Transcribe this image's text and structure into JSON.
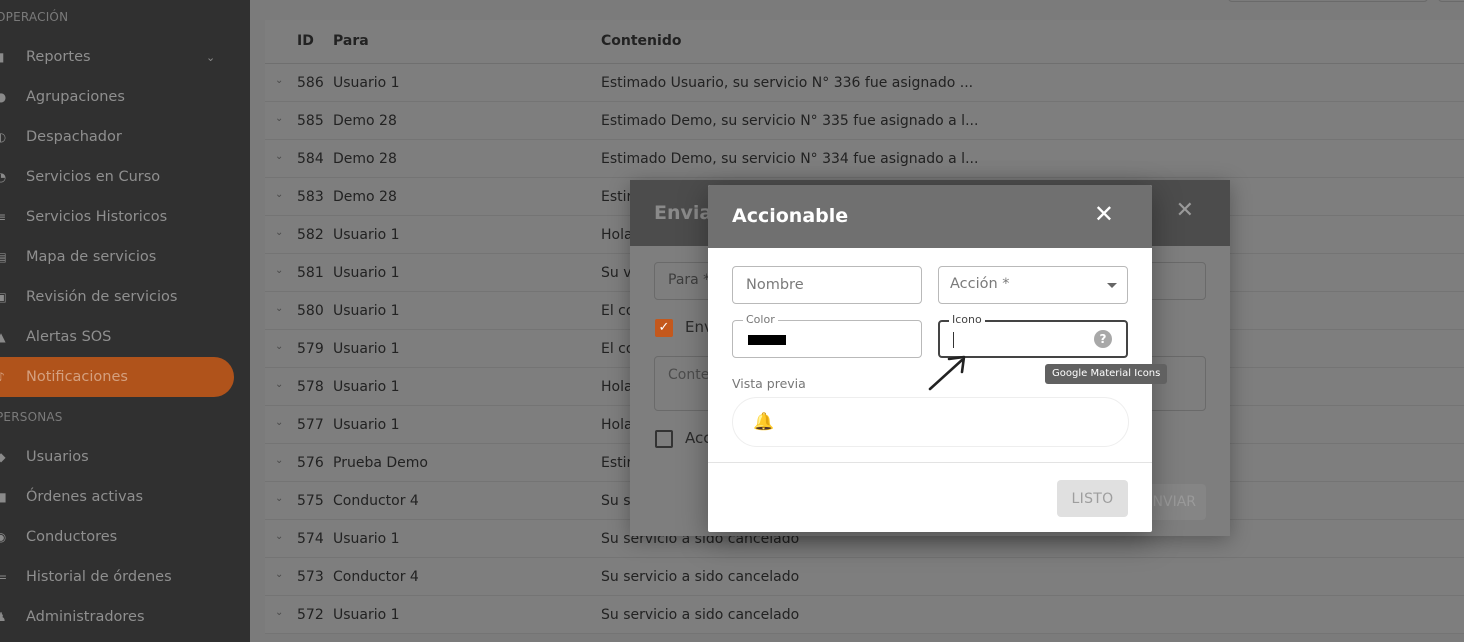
{
  "sidebar": {
    "section_operacion": "OPERACIÓN",
    "section_personas": "PERSONAS",
    "items_operacion": [
      {
        "label": "Reportes",
        "icon": "bar-chart-icon",
        "has_chevron": true
      },
      {
        "label": "Agrupaciones",
        "icon": "globe-icon"
      },
      {
        "label": "Despachador",
        "icon": "dispatch-icon"
      },
      {
        "label": "Servicios en Curso",
        "icon": "clock-icon"
      },
      {
        "label": "Servicios Historicos",
        "icon": "list-icon"
      },
      {
        "label": "Mapa de servicios",
        "icon": "map-icon"
      },
      {
        "label": "Revisión de servicios",
        "icon": "review-icon"
      },
      {
        "label": "Alertas SOS",
        "icon": "warning-icon"
      },
      {
        "label": "Notificaciones",
        "icon": "bell-icon",
        "active": true
      }
    ],
    "items_personas": [
      {
        "label": "Usuarios",
        "icon": "users-icon"
      },
      {
        "label": "Órdenes activas",
        "icon": "orders-icon"
      },
      {
        "label": "Conductores",
        "icon": "driver-icon"
      },
      {
        "label": "Historial de órdenes",
        "icon": "history-icon"
      },
      {
        "label": "Administradores",
        "icon": "admin-icon"
      }
    ]
  },
  "table": {
    "headers": {
      "id": "ID",
      "para": "Para",
      "contenido": "Contenido"
    },
    "rows": [
      {
        "id": "586",
        "para": "Usuario 1",
        "contenido": "Estimado Usuario, su servicio N° 336 fue asignado ..."
      },
      {
        "id": "585",
        "para": "Demo 28",
        "contenido": "Estimado Demo, su servicio N° 335 fue asignado a l..."
      },
      {
        "id": "584",
        "para": "Demo 28",
        "contenido": "Estimado Demo, su servicio N° 334 fue asignado a l..."
      },
      {
        "id": "583",
        "para": "Demo 28",
        "contenido": "Estir"
      },
      {
        "id": "582",
        "para": "Usuario 1",
        "contenido": "Hola"
      },
      {
        "id": "581",
        "para": "Usuario 1",
        "contenido": "Su v"
      },
      {
        "id": "580",
        "para": "Usuario 1",
        "contenido": "El co"
      },
      {
        "id": "579",
        "para": "Usuario 1",
        "contenido": "El co"
      },
      {
        "id": "578",
        "para": "Usuario 1",
        "contenido": "Hola"
      },
      {
        "id": "577",
        "para": "Usuario 1",
        "contenido": "Hola"
      },
      {
        "id": "576",
        "para": "Prueba Demo",
        "contenido": "Estir"
      },
      {
        "id": "575",
        "para": "Conductor 4",
        "contenido": "Su s"
      },
      {
        "id": "574",
        "para": "Usuario 1",
        "contenido": "Su servicio a sido cancelado"
      },
      {
        "id": "573",
        "para": "Conductor 4",
        "contenido": "Su servicio a sido cancelado"
      },
      {
        "id": "572",
        "para": "Usuario 1",
        "contenido": "Su servicio a sido cancelado"
      }
    ]
  },
  "enviar_dialog": {
    "title": "Enviar",
    "close": "✕",
    "para_placeholder": "Para *",
    "check1_label": "Env",
    "contenido_placeholder": "Conter",
    "check2_label": "Acc",
    "send_label": "NVIAR"
  },
  "accionable_dialog": {
    "title": "Accionable",
    "close": "✕",
    "nombre_placeholder": "Nombre",
    "accion_placeholder": "Acción *",
    "color_label": "Color",
    "color_value": "#000000",
    "icono_label": "Icono",
    "icono_value": "",
    "help_glyph": "?",
    "tooltip": "Google Material Icons",
    "preview_label": "Vista previa",
    "preview_icon": "bell-icon",
    "done_label": "LISTO"
  },
  "colors": {
    "sidebar_bg": "#303030",
    "active_item": "#b0531b",
    "overlay": "#7b7b7b",
    "dialog_header": "#707070",
    "enviar_checkbox": "#c4581c"
  }
}
